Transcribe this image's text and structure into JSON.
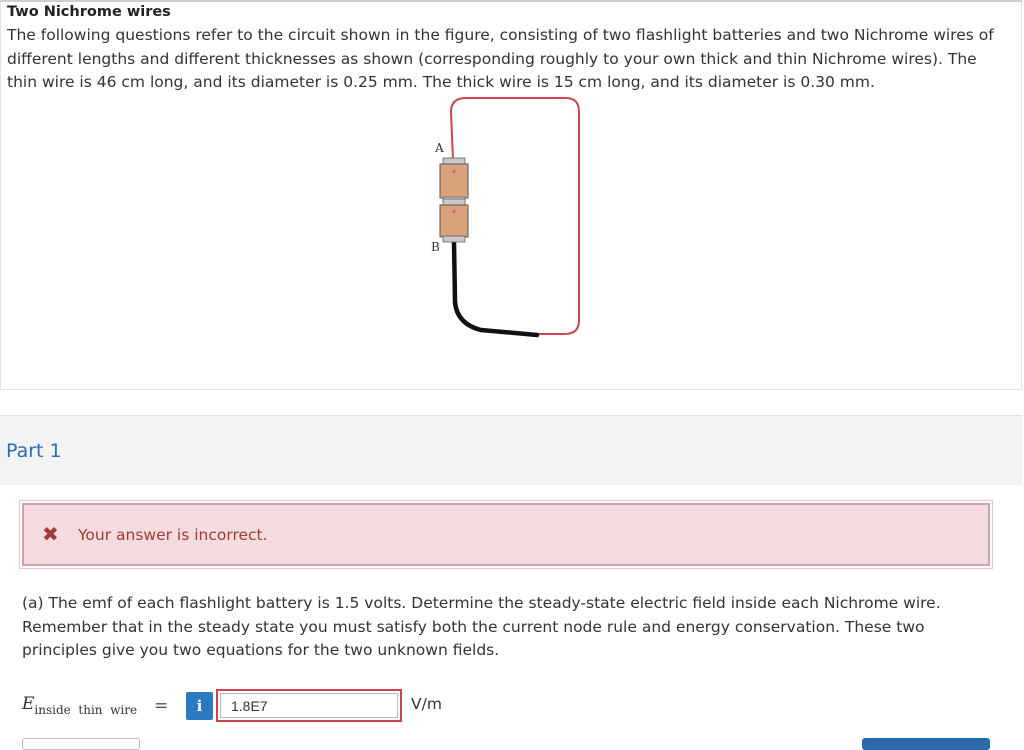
{
  "question": {
    "title": "Two Nichrome wires",
    "body": "The following questions refer to the circuit shown in the figure, consisting of two flashlight batteries and two Nichrome wires of different lengths and different thicknesses as shown (corresponding roughly to your own thick and thin Nichrome wires). The thin wire is 46 cm long, and its diameter is 0.25 mm. The thick wire is 15 cm long, and its diameter is 0.30 mm.",
    "figure": {
      "label_a": "A",
      "label_b": "B",
      "thin_wire_color": "#c8464d",
      "thick_wire_color": "#111111",
      "battery_color": "#d9a27a"
    }
  },
  "part": {
    "title": "Part 1"
  },
  "alert": {
    "icon": "close-x-icon",
    "message": "Your answer is incorrect."
  },
  "prompt": "(a) The emf of each flashlight battery is 1.5 volts. Determine the steady-state electric field inside each Nichrome wire. Remember that in the steady state you must satisfy both the current node rule and energy conservation. These two principles give you two equations for the two unknown fields.",
  "equation": {
    "variable": "E",
    "subscript": "inside  thin  wire",
    "sign": "=",
    "info_icon": "i",
    "answer_value": "1.8E7",
    "unit": "V/m"
  },
  "colors": {
    "accent_blue": "#2a7ac0",
    "error_red": "#a33a36",
    "error_bg": "#f4dcde",
    "part_title": "#2a6db0"
  }
}
